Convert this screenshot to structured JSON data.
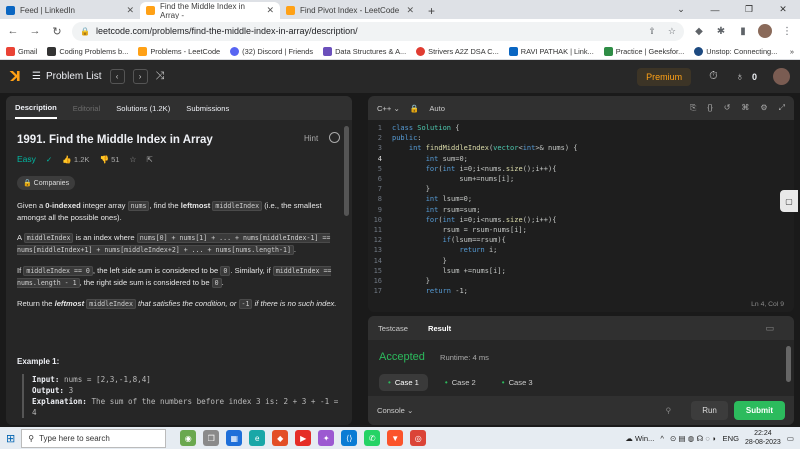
{
  "browser": {
    "tabs": [
      {
        "label": "Feed | LinkedIn",
        "color": "#0a66c2"
      },
      {
        "label": "Find the Middle Index in Array - ",
        "color": "#ffa116",
        "active": true
      },
      {
        "label": "Find Pivot Index - LeetCode",
        "color": "#ffa116"
      }
    ],
    "new_tab": "+",
    "url": "leetcode.com/problems/find-the-middle-index-in-array/description/",
    "bookmarks": [
      {
        "label": "Gmail",
        "color": "#ea4335"
      },
      {
        "label": "Coding Problems b...",
        "color": "#333333"
      },
      {
        "label": "Problems - LeetCode",
        "color": "#ffa116"
      },
      {
        "label": "(32) Discord | Friends",
        "color": "#5865f2"
      },
      {
        "label": "Data Structures & A...",
        "color": "#6b4fbb"
      },
      {
        "label": "Strivers A2Z DSA C...",
        "color": "#e03c31"
      },
      {
        "label": "RAVI PATHAK | Link...",
        "color": "#0a66c2"
      },
      {
        "label": "Practice | Geeksfor...",
        "color": "#2f8d46"
      },
      {
        "label": "Unstop: Connecting...",
        "color": "#1c4980"
      }
    ]
  },
  "lc": {
    "nav": {
      "problem_list": "Problem List",
      "premium": "Premium",
      "streak": "0"
    },
    "left": {
      "tabs": [
        "Description",
        "Editorial",
        "Solutions (1.2K)",
        "Submissions"
      ],
      "title": "1991. Find the Middle Index in Array",
      "hint": "Hint",
      "difficulty": "Easy",
      "likes": "1.2K",
      "dislikes": "51",
      "companies": "Companies",
      "p1_a": "Given a ",
      "p1_b": "0-indexed",
      "p1_c": " integer array ",
      "p1_code1": "nums",
      "p1_d": ", find the ",
      "p1_e": "leftmost",
      "p1_code2": "middleIndex",
      "p1_f": " (i.e., the smallest amongst all the possible ones).",
      "p2_a": "A ",
      "p2_code1": "middleIndex",
      "p2_b": " is an index where ",
      "p2_code2": "nums[0] + nums[1] + ... + nums[middleIndex-1] == nums[middleIndex+1] + nums[middleIndex+2] + ... + nums[nums.length-1]",
      "p2_c": ".",
      "p3_a": "If ",
      "p3_code1": "middleIndex == 0",
      "p3_b": ", the left side sum is considered to be ",
      "p3_code2": "0",
      "p3_c": ". Similarly, if ",
      "p3_code3": "middleIndex == nums.length - 1",
      "p3_d": ", the right side sum is considered to be ",
      "p3_code4": "0",
      "p3_e": ".",
      "p4_a": "Return the ",
      "p4_b": "leftmost",
      "p4_code1": "middleIndex",
      "p4_c": " that satisfies the condition, or ",
      "p4_code2": "-1",
      "p4_d": " if there is no such index.",
      "example_title": "Example 1:",
      "ex_input_label": "Input:",
      "ex_input": " nums = [2,3,-1,8,4]",
      "ex_output_label": "Output:",
      "ex_output": " 3",
      "ex_expl_label": "Explanation:",
      "ex_expl": " The sum of the numbers before index 3 is: 2 + 3 + -1 = 4"
    },
    "editor": {
      "language": "C++",
      "mode": "Auto",
      "cursor": "Ln 4, Col 9",
      "lines": [
        {
          "n": "1",
          "t": "class Solution {"
        },
        {
          "n": "2",
          "t": "public:"
        },
        {
          "n": "3",
          "t": "    int findMiddleIndex(vector<int>& nums) {"
        },
        {
          "n": "4",
          "t": "        int sum=0;"
        },
        {
          "n": "5",
          "t": "        for(int i=0;i<nums.size();i++){"
        },
        {
          "n": "6",
          "t": "                sum+=nums[i];"
        },
        {
          "n": "7",
          "t": "        }"
        },
        {
          "n": "8",
          "t": "        int lsum=0;"
        },
        {
          "n": "9",
          "t": "        int rsum=sum;"
        },
        {
          "n": "10",
          "t": "        for(int i=0;i<nums.size();i++){"
        },
        {
          "n": "11",
          "t": "            rsum = rsum-nums[i];"
        },
        {
          "n": "12",
          "t": "            if(lsum==rsum){"
        },
        {
          "n": "13",
          "t": "                return i;"
        },
        {
          "n": "14",
          "t": "            }"
        },
        {
          "n": "15",
          "t": "            lsum +=nums[i];"
        },
        {
          "n": "16",
          "t": "        }"
        },
        {
          "n": "17",
          "t": "        return -1;"
        }
      ]
    },
    "result": {
      "tabs": [
        "Testcase",
        "Result"
      ],
      "status": "Accepted",
      "runtime": "Runtime: 4 ms",
      "cases": [
        "Case 1",
        "Case 2",
        "Case 3"
      ],
      "console": "Console",
      "run": "Run",
      "submit": "Submit"
    }
  },
  "taskbar": {
    "search_placeholder": "Type here to search",
    "weather": "Win...",
    "lang": "ENG",
    "time": "22:24",
    "date": "28-08-2023"
  }
}
